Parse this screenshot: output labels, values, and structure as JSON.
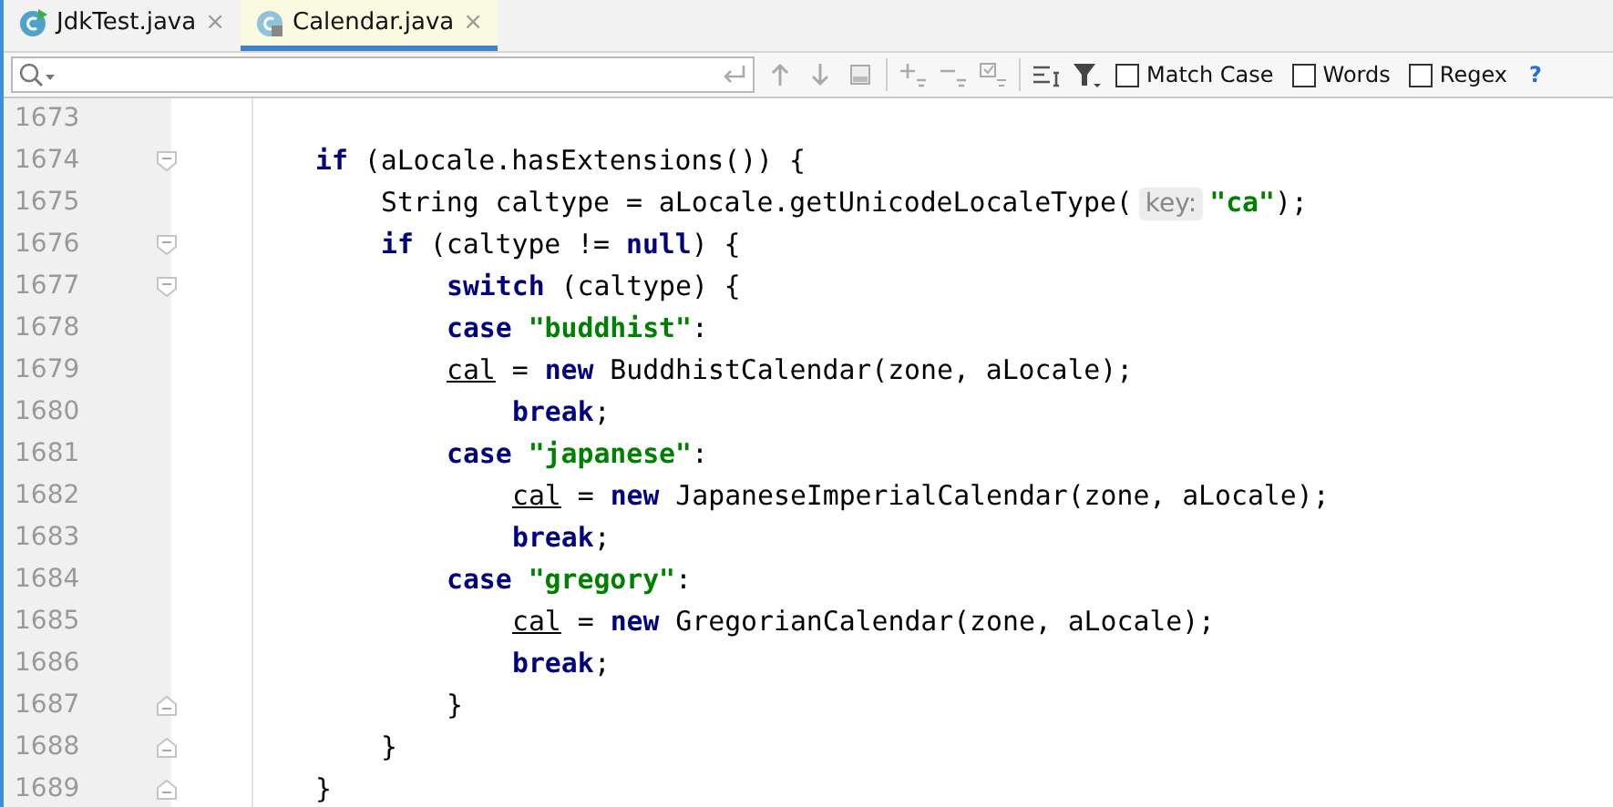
{
  "tabs": [
    {
      "label": "JdkTest.java",
      "selected": false,
      "close": "×"
    },
    {
      "label": "Calendar.java",
      "selected": true,
      "close": "×"
    }
  ],
  "search": {
    "options": [
      {
        "label": "Match Case",
        "checked": false
      },
      {
        "label": "Words",
        "checked": false
      },
      {
        "label": "Regex",
        "checked": false
      }
    ],
    "help": "?"
  },
  "lines": [
    {
      "number": "1673"
    },
    {
      "number": "1674",
      "kind": "fold_start",
      "tokens": [
        {
          "kind": "keyword",
          "text": "if"
        },
        {
          "kind": "plain",
          "text": " (aLocale.hasExtensions()) {"
        }
      ],
      "children": [
        {
          "number": "1675",
          "tokens": [
            {
              "kind": "plain",
              "text": "String caltype = aLocale.getUnicodeLocaleType("
            },
            {
              "kind": "hint",
              "text": "key:"
            },
            {
              "kind": "string",
              "text": "\"ca\""
            },
            {
              "kind": "plain",
              "text": ");"
            }
          ]
        },
        {
          "number": "1676",
          "kind": "fold_start",
          "tokens": [
            {
              "kind": "keyword",
              "text": "if"
            },
            {
              "kind": "plain",
              "text": " (caltype != "
            },
            {
              "kind": "keyword",
              "text": "null"
            },
            {
              "kind": "plain",
              "text": ") {"
            }
          ],
          "children": [
            {
              "number": "1677",
              "kind": "fold_start",
              "tokens": [
                {
                  "kind": "keyword",
                  "text": "switch"
                },
                {
                  "kind": "plain",
                  "text": " (caltype) {"
                }
              ]
            },
            {
              "number": "1678",
              "tokens": [
                {
                  "kind": "keyword",
                  "text": "case "
                },
                {
                  "kind": "string",
                  "text": "\"buddhist\""
                },
                {
                  "kind": "plain",
                  "text": ":"
                }
              ]
            },
            {
              "number": "1679",
              "tokens": [
                {
                  "kind": "field",
                  "text": "cal"
                },
                {
                  "kind": "plain",
                  "text": " = "
                },
                {
                  "kind": "keyword",
                  "text": "new"
                },
                {
                  "kind": "plain",
                  "text": " BuddhistCalendar(zone, aLocale);"
                }
              ],
              "children": [
                {
                  "number": "1680",
                  "tokens": [
                    {
                      "kind": "keyword",
                      "text": "break"
                    },
                    {
                      "kind": "plain",
                      "text": ";"
                    }
                  ]
                }
              ]
            },
            {
              "number": "1681",
              "tokens": [
                {
                  "kind": "keyword",
                  "text": "case "
                },
                {
                  "kind": "string",
                  "text": "\"japanese\""
                },
                {
                  "kind": "plain",
                  "text": ":"
                }
              ],
              "children": [
                {
                  "number": "1682",
                  "tokens": [
                    {
                      "kind": "field",
                      "text": "cal"
                    },
                    {
                      "kind": "plain",
                      "text": " = "
                    },
                    {
                      "kind": "keyword",
                      "text": "new"
                    },
                    {
                      "kind": "plain",
                      "text": " JapaneseImperialCalendar(zone, aLocale);"
                    }
                  ]
                },
                {
                  "number": "1683",
                  "tokens": [
                    {
                      "kind": "keyword",
                      "text": "break"
                    },
                    {
                      "kind": "plain",
                      "text": ";"
                    }
                  ]
                }
              ]
            },
            {
              "number": "1684",
              "tokens": [
                {
                  "kind": "keyword",
                  "text": "case "
                },
                {
                  "kind": "string",
                  "text": "\"gregory\""
                },
                {
                  "kind": "plain",
                  "text": ":"
                }
              ],
              "children": [
                {
                  "number": "1685",
                  "tokens": [
                    {
                      "kind": "field",
                      "text": "cal"
                    },
                    {
                      "kind": "plain",
                      "text": " = "
                    },
                    {
                      "kind": "keyword",
                      "text": "new"
                    },
                    {
                      "kind": "plain",
                      "text": " GregorianCalendar(zone, aLocale);"
                    }
                  ]
                },
                {
                  "number": "1686",
                  "tokens": [
                    {
                      "kind": "keyword",
                      "text": "break"
                    },
                    {
                      "kind": "plain",
                      "text": ";"
                    }
                  ]
                }
              ]
            },
            {
              "number": "1687",
              "kind": "fold_end",
              "tokens": [
                {
                  "kind": "plain",
                  "text": "}"
                }
              ]
            }
          ]
        },
        {
          "number": "1688",
          "kind": "fold_end",
          "tokens": [
            {
              "kind": "plain",
              "text": "}"
            }
          ]
        }
      ]
    },
    {
      "number": "1689",
      "kind": "fold_end",
      "tokens": [
        {
          "kind": "plain",
          "text": "}"
        }
      ]
    }
  ]
}
